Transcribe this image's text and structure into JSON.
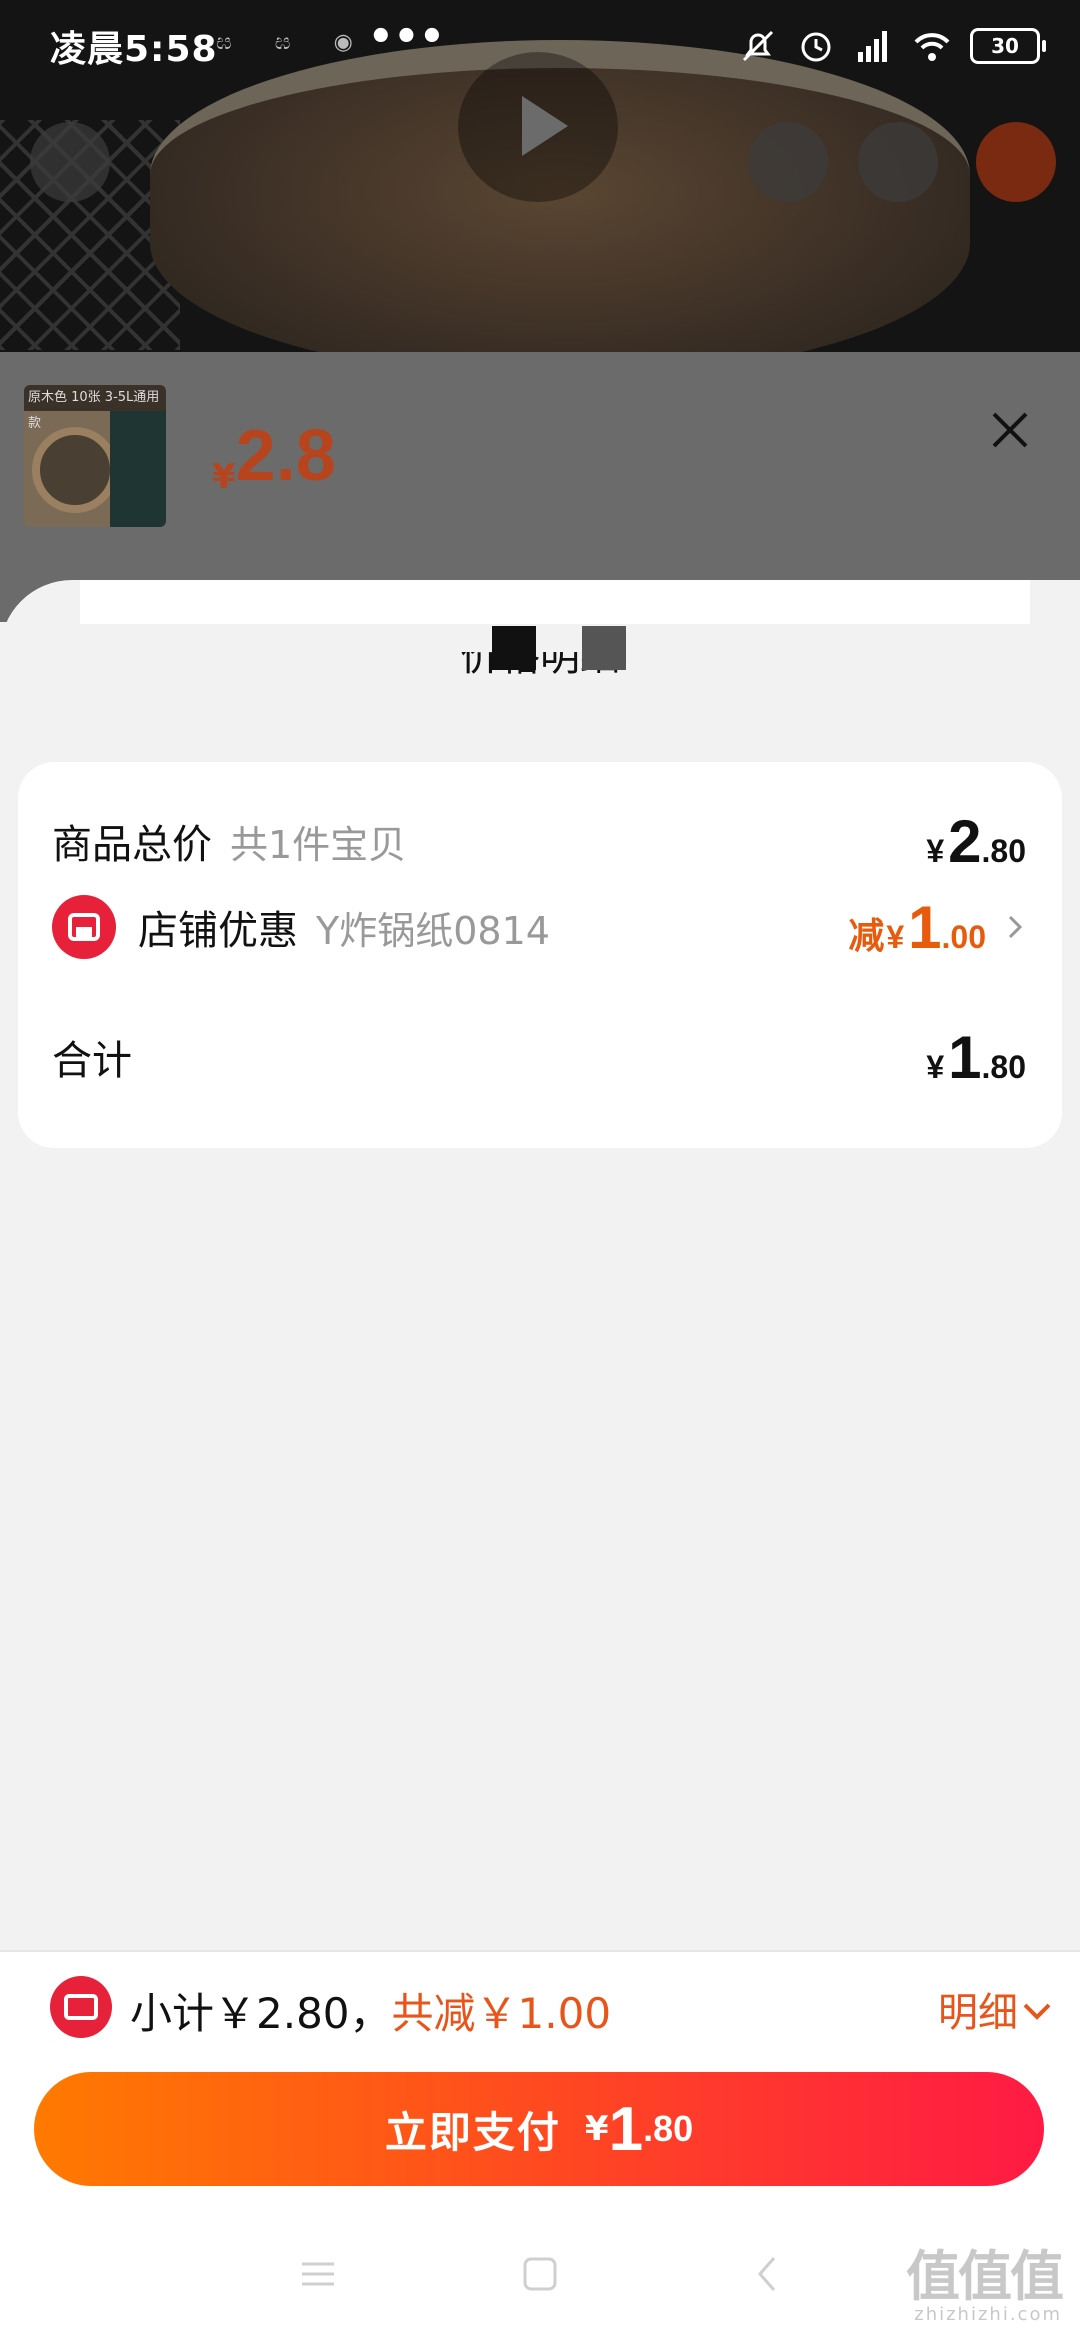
{
  "status_bar": {
    "time": "凌晨5:58",
    "icons_mini": "ඝ ඝ ◉",
    "dots": "•••",
    "battery": "30"
  },
  "header": {
    "currency": "¥",
    "price": "2.8",
    "thumb_caption": "原木色 10张 3-5L通用款"
  },
  "sheet": {
    "title": "价格明细"
  },
  "price_rows": [
    {
      "label": "商品总价",
      "sub": "共1件宝贝",
      "currency": "¥",
      "big": "2",
      "small": ".80"
    },
    {
      "label": "店铺优惠",
      "sub": "Y炸锅纸0814",
      "prefix": "减",
      "currency": "¥",
      "big": "1",
      "small": ".00"
    },
    {
      "label": "合计",
      "currency": "¥",
      "big": "1",
      "small": ".80"
    }
  ],
  "bottom": {
    "subtotal": "小计￥2.80，",
    "discount": "共减￥1.00",
    "detail": "明细",
    "pay_label": "立即支付",
    "pay_currency": "¥",
    "pay_big": "1",
    "pay_small": ".80"
  },
  "watermark": {
    "cn": "值值值",
    "en": "zhizhizhi.com"
  },
  "colors": {
    "accent": "#e85a0c",
    "shop_red": "#e8213a",
    "pay_start": "#ff7a00",
    "pay_end": "#ff1a44"
  },
  "icons": [
    "mute-bell-icon",
    "alarm-icon",
    "signal-icon",
    "wifi-icon",
    "close-icon",
    "shop-icon",
    "chevron-right-icon",
    "coupon-icon",
    "chevron-down-icon",
    "menu-nav-icon",
    "home-nav-icon",
    "back-nav-icon"
  ]
}
